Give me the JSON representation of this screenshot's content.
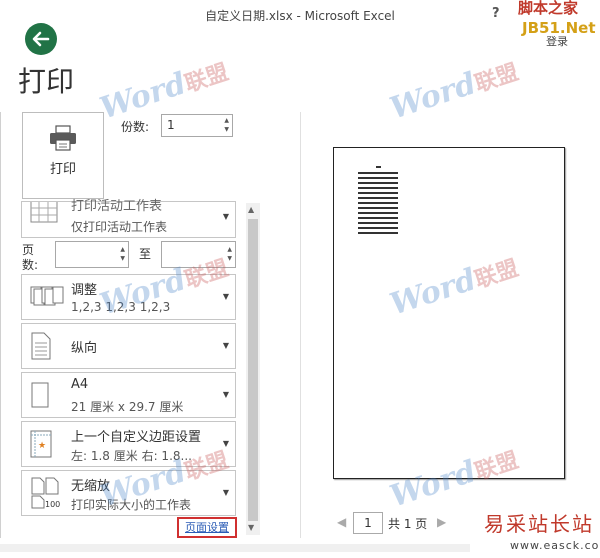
{
  "window": {
    "title": "自定义日期.xlsx - Microsoft Excel",
    "help": "?",
    "signin": "登录"
  },
  "backstage": {
    "title": "打印"
  },
  "print": {
    "button_label": "打印",
    "copies_label": "份数:",
    "copies_value": "1"
  },
  "settings": {
    "scope_top": "打印活动工作表",
    "scope_bottom": "仅打印活动工作表",
    "pages_label_1": "页",
    "pages_label_2": "数:",
    "pages_to": "至",
    "collate_title": "调整",
    "collate_sub": "1,2,3    1,2,3    1,2,3",
    "orientation": "纵向",
    "paper_title": "A4",
    "paper_sub": "21 厘米 x 29.7 厘米",
    "margins_title": "上一个自定义边距设置",
    "margins_sub": "左: 1.8 厘米    右: 1.8...",
    "scaling_title": "无缩放",
    "scaling_sub": "打印实际大小的工作表",
    "page_setup": "页面设置"
  },
  "preview_nav": {
    "current": "1",
    "total_text": "共 1 页"
  },
  "watermarks": {
    "site_top": "脚本之家",
    "site_top2": "JB51.Net",
    "brand_en": "Word",
    "brand_cn": "联盟",
    "site_bottom": "易采站长站",
    "site_url": "www.easck.com"
  }
}
